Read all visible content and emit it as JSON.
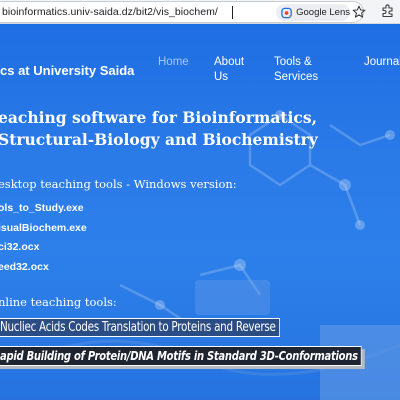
{
  "browser": {
    "url": "bioinformatics.univ-saida.dz/bit2/vis_biochem/",
    "lens_label": "Google Lens",
    "icons": [
      "google-lens-icon",
      "bookmark-star-icon",
      "extensions-icon"
    ]
  },
  "site": {
    "title": "cs at University Saida",
    "nav": [
      "Home",
      "About Us",
      "Tools & Services",
      "Journal Blog"
    ]
  },
  "main": {
    "heading": "eaching software for Bioinformatics, Structural-Biology and Biochemistry",
    "desktop_title": "esktop teaching tools - Windows version:",
    "downloads": [
      "ols_to_Study.exe",
      "isualBiochem.exe",
      "ci32.ocx",
      "eed32.ocx"
    ],
    "online_title": "nline teaching tools:",
    "online_links": [
      "Nucliec Acids Codes Translation to Proteins and Reverse",
      "apid Building of Protein/DNA Motifs in Standard 3D-Conformations"
    ]
  },
  "colors": {
    "page_blue": "#2a7ae8",
    "nav_active": "#a8c6f2",
    "link1_bg": "#2b4d85",
    "link2_bg": "#1f2431"
  }
}
